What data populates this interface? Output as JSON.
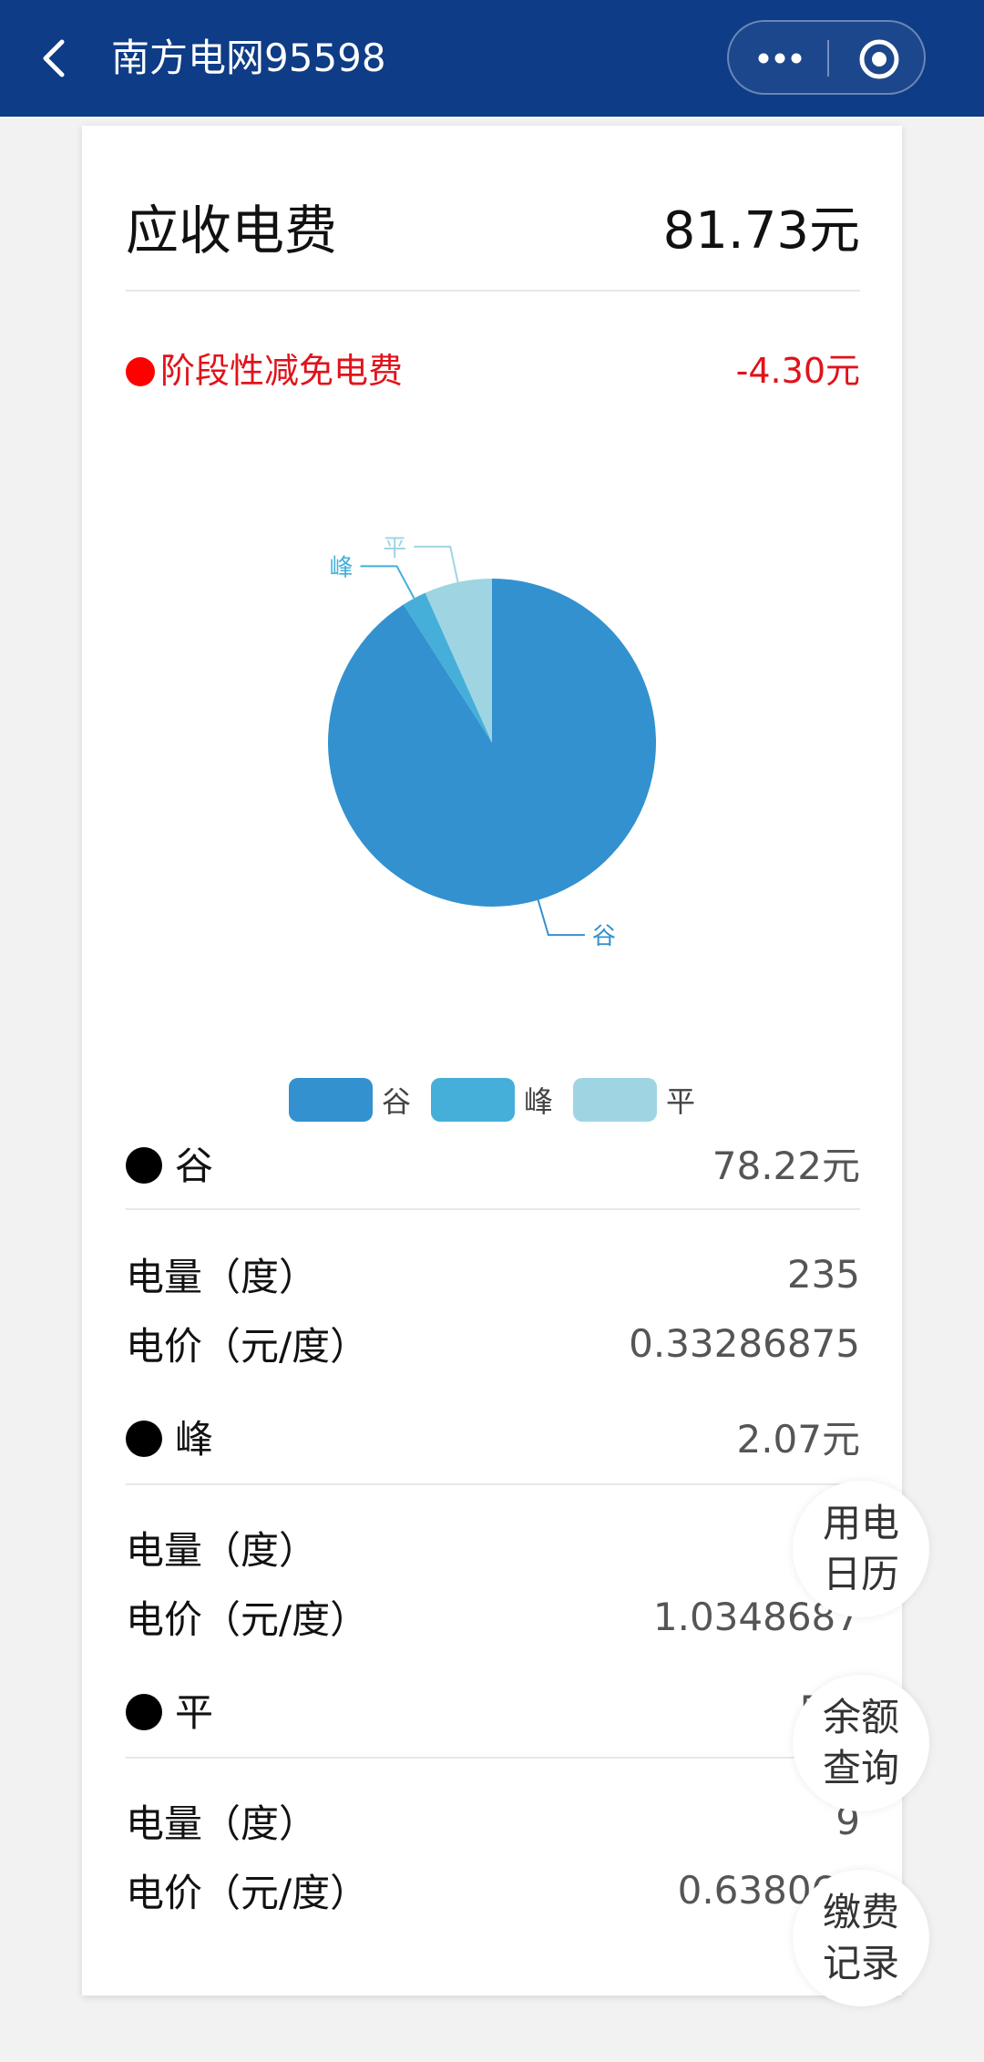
{
  "nav": {
    "title": "南方电网95598",
    "more_icon": "more-icon",
    "target_icon": "target-icon"
  },
  "summary": {
    "total_label": "应收电费",
    "total_value": "81.73元",
    "reduction_label": "阶段性减免电费",
    "reduction_value": "-4.30元"
  },
  "colors": {
    "gu": "#3391cf",
    "feng": "#45afd9",
    "ping": "#9fd5e3",
    "red": "#e0131b",
    "nav": "#0e3c86"
  },
  "chart_data": {
    "type": "pie",
    "slices": [
      {
        "label": "谷",
        "value": 78.22,
        "color": "#3391cf"
      },
      {
        "label": "峰",
        "value": 2.07,
        "color": "#45afd9"
      },
      {
        "label": "平",
        "value": 5.74,
        "color": "#9fd5e3"
      }
    ],
    "legend": [
      "谷",
      "峰",
      "平"
    ],
    "legend_position": "bottom"
  },
  "sections": [
    {
      "name": "谷",
      "amount": "78.22元",
      "qty_label": "电量（度）",
      "qty_value": "235",
      "price_label": "电价（元/度）",
      "price_value": "0.33286875"
    },
    {
      "name": "峰",
      "amount": "2.07元",
      "qty_label": "电量（度）",
      "qty_value": "",
      "price_label": "电价（元/度）",
      "price_value": "1.0348687"
    },
    {
      "name": "平",
      "amount": "5.7",
      "qty_label": "电量（度）",
      "qty_value": "9",
      "price_label": "电价（元/度）",
      "price_value": "0.638061"
    }
  ],
  "floating": [
    {
      "line1": "用电",
      "line2": "日历"
    },
    {
      "line1": "余额",
      "line2": "查询"
    },
    {
      "line1": "缴费",
      "line2": "记录"
    }
  ]
}
